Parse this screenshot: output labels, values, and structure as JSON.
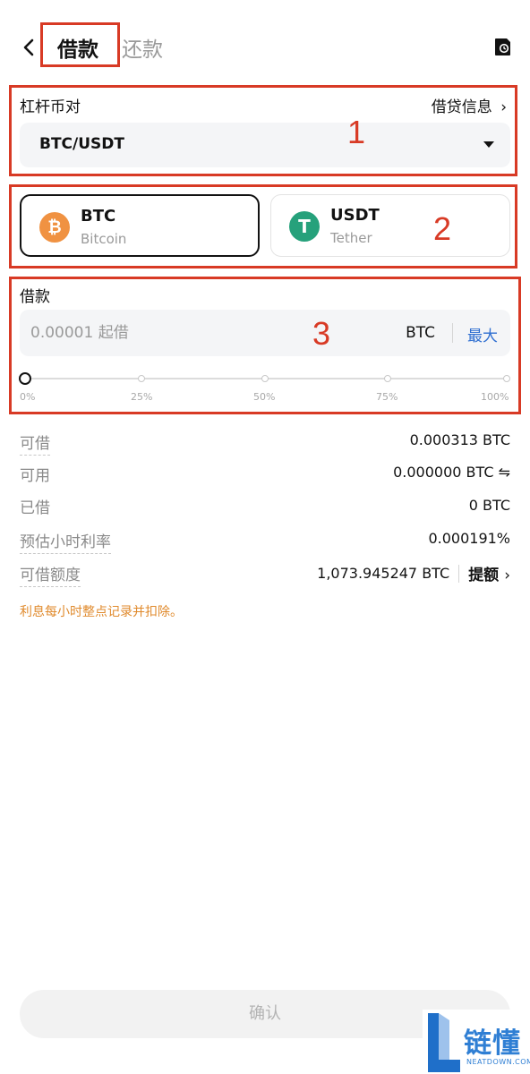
{
  "header": {
    "tab_borrow": "借款",
    "tab_repay": "还款",
    "back_icon": "chevron-left-icon",
    "history_icon": "history-icon"
  },
  "section_pair": {
    "label": "杠杆币对",
    "info_link": "借贷信息",
    "selected_pair": "BTC/USDT"
  },
  "coins": [
    {
      "symbol": "BTC",
      "name": "Bitcoin",
      "logo_letter": "₿",
      "color": "#f09242",
      "selected": true
    },
    {
      "symbol": "USDT",
      "name": "Tether",
      "logo_letter": "T",
      "color": "#26a17b",
      "selected": false
    }
  ],
  "borrow": {
    "label": "借款",
    "placeholder": "0.00001 起借",
    "unit": "BTC",
    "max_label": "最大",
    "percent": 0,
    "slider_marks": [
      "0%",
      "25%",
      "50%",
      "75%",
      "100%"
    ]
  },
  "info": {
    "borrowable_label": "可借",
    "borrowable_value": "0.000313 BTC",
    "available_label": "可用",
    "available_value": "0.000000 BTC ⇋",
    "borrowed_label": "已借",
    "borrowed_value": "0 BTC",
    "rate_label": "预估小时利率",
    "rate_value": "0.000191%",
    "limit_label": "可借额度",
    "limit_value": "1,073.945247 BTC",
    "raise_label": "提额"
  },
  "note": "利息每小时整点记录并扣除。",
  "confirm_label": "确认",
  "annotations": [
    "1",
    "2",
    "3"
  ],
  "watermark": {
    "text": "链懂",
    "sub": "NEATDOWN.COM"
  },
  "colors": {
    "accent_blue": "#2f6fd1",
    "annotation_red": "#d83a25",
    "note_orange": "#e08a2c"
  }
}
